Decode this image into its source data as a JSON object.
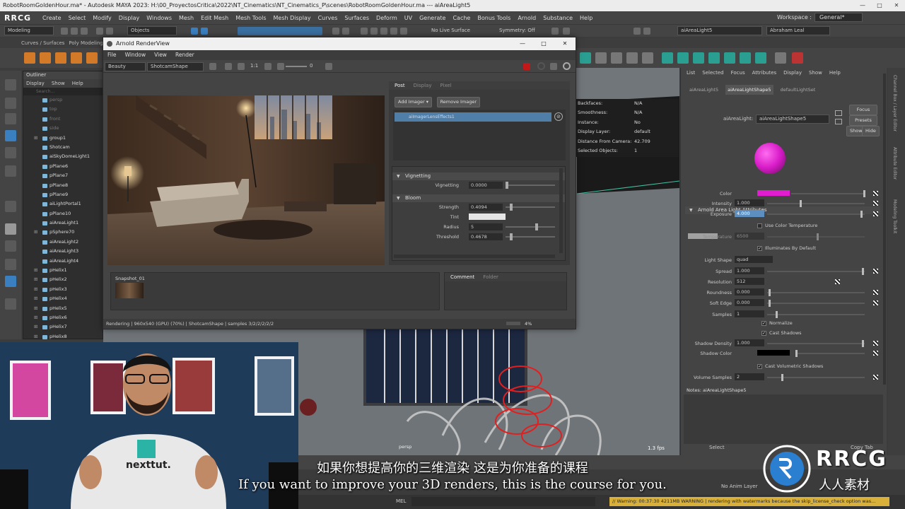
{
  "app": {
    "title": "RobotRoomGoldenHour.ma* - Autodesk MAYA 2023: H:\\00_ProyectosCritica\\2022\\NT_Cinematics\\NT_Cinematics_P\\scenes\\RobotRoomGoldenHour.ma  ---  aiAreaLight5",
    "menus": [
      "Create",
      "Select",
      "Modify",
      "Display",
      "Windows",
      "Mesh",
      "Edit Mesh",
      "Mesh Tools",
      "Mesh Display",
      "Curves",
      "Surfaces",
      "Deform",
      "UV",
      "Generate",
      "Cache",
      "Bonus Tools",
      "Arnold",
      "Substance",
      "Help"
    ],
    "workspace_label": "Workspace :",
    "workspace_value": "General*",
    "mode": "Modeling",
    "objects_label": "Objects",
    "live_surface": "No Live Surface",
    "symmetry": "Symmetry: Off",
    "selected_name": "aiAreaLight5",
    "user": "Abraham Leal",
    "shelf_tabs": [
      "Curves / Surfaces",
      "Poly Modeling"
    ]
  },
  "outliner": {
    "title": "Outliner",
    "menu": [
      "Display",
      "Show",
      "Help"
    ],
    "search": "Search...",
    "items": [
      {
        "label": "persp",
        "dim": true
      },
      {
        "label": "top",
        "dim": true
      },
      {
        "label": "front",
        "dim": true
      },
      {
        "label": "side",
        "dim": true
      },
      {
        "label": "group1",
        "dim": false,
        "expand": true
      },
      {
        "label": "Shotcam",
        "dim": false
      },
      {
        "label": "aiSkyDomeLight1",
        "dim": false
      },
      {
        "label": "pPlane6",
        "dim": false
      },
      {
        "label": "pPlane7",
        "dim": false
      },
      {
        "label": "pPlane8",
        "dim": false
      },
      {
        "label": "pPlane9",
        "dim": false
      },
      {
        "label": "aiLightPortal1",
        "dim": false
      },
      {
        "label": "pPlane10",
        "dim": false
      },
      {
        "label": "aiAreaLight1",
        "dim": false
      },
      {
        "label": "pSphere70",
        "dim": false,
        "expand": true
      },
      {
        "label": "aiAreaLight2",
        "dim": false
      },
      {
        "label": "aiAreaLight3",
        "dim": false
      },
      {
        "label": "aiAreaLight4",
        "dim": false
      },
      {
        "label": "pHelix1",
        "dim": false,
        "expand": true
      },
      {
        "label": "pHelix2",
        "dim": false,
        "expand": true
      },
      {
        "label": "pHelix3",
        "dim": false,
        "expand": true
      },
      {
        "label": "pHelix4",
        "dim": false,
        "expand": true
      },
      {
        "label": "pHelix5",
        "dim": false,
        "expand": true
      },
      {
        "label": "pHelix6",
        "dim": false,
        "expand": true
      },
      {
        "label": "pHelix7",
        "dim": false,
        "expand": true
      },
      {
        "label": "pHelix8",
        "dim": false,
        "expand": true
      }
    ]
  },
  "renderview": {
    "title": "Arnold RenderView",
    "menu": [
      "File",
      "Window",
      "View",
      "Render"
    ],
    "aov": "Beauty",
    "camera": "ShotcamShape",
    "ratio": "1:1",
    "exposure_value": "0",
    "tabs": [
      "Post",
      "Display",
      "Pixel"
    ],
    "add_imager": "Add Imager",
    "remove_imager": "Remove Imager",
    "imager_name": "aiImagerLensEffects1",
    "vignetting_section": "Vignetting",
    "vignetting_label": "Vignetting",
    "vignetting_value": "0.0000",
    "vignetting_level": 0.0,
    "bloom_section": "Bloom",
    "strength_label": "Strength",
    "strength_value": "0.4094",
    "tint_label": "Tint",
    "radius_label": "Radius",
    "radius_value": "5",
    "threshold_label": "Threshold",
    "threshold_value": "0.4678",
    "snapshot_label": "Snapshot_01",
    "comment_tabs": [
      "Comment",
      "Folder"
    ],
    "status": "Rendering | 960x540 (GPU) (70%) | ShotcamShape | samples 3/2/2/2/2/2",
    "zoom": "4%"
  },
  "hud": {
    "rows": [
      {
        "l": "Backfaces:",
        "v": "N/A"
      },
      {
        "l": "Smoothness:",
        "v": "N/A"
      },
      {
        "l": "Instance:",
        "v": "No"
      },
      {
        "l": "Display Layer:",
        "v": "default"
      },
      {
        "l": "Distance From Camera:",
        "v": "42.709"
      },
      {
        "l": "Selected Objects:",
        "v": "1"
      }
    ],
    "camera": "persp",
    "fps": "1.3 fps"
  },
  "attr": {
    "menu": [
      "List",
      "Selected",
      "Focus",
      "Attributes",
      "Display",
      "Show",
      "Help"
    ],
    "tabs": [
      "aiAreaLight5",
      "aiAreaLightShape5",
      "defaultLightSet"
    ],
    "node_label": "aiAreaLight:",
    "node_value": "aiAreaLightShape5",
    "focus": "Focus",
    "presets": "Presets",
    "show": "Show",
    "hide": "Hide",
    "section": "Arnold Area Light Attributes",
    "color_label": "Color",
    "intensity_label": "Intensity",
    "intensity_value": "1.000",
    "exposure_label": "Exposure",
    "exposure_value": "4.000",
    "use_color_temp": "Use Color Temperature",
    "temperature_label": "Temperature",
    "temperature_value": "6500",
    "illuminates": "Illuminates By Default",
    "light_shape_label": "Light Shape",
    "light_shape_value": "quad",
    "spread_label": "Spread",
    "spread_value": "1.000",
    "resolution_label": "Resolution",
    "resolution_value": "512",
    "roundness_label": "Roundness",
    "roundness_value": "0.000",
    "softedge_label": "Soft Edge",
    "softedge_value": "0.000",
    "samples_label": "Samples",
    "samples_value": "1",
    "normalize": "Normalize",
    "cast_shadows": "Cast Shadows",
    "shadow_density_label": "Shadow Density",
    "shadow_density_value": "1.000",
    "shadow_color_label": "Shadow Color",
    "cast_vol_shadows": "Cast Volumetric Shadows",
    "vol_samples_label": "Volume Samples",
    "vol_samples_value": "2",
    "notes": "Notes:  aiAreaLightShape5",
    "select_btn": "Select",
    "copy_tab": "Copy Tab",
    "color_hex": "#e01ed0"
  },
  "right_strip": [
    "Channel Box / Layer Editor",
    "Attribute Editor",
    "Modeling Toolkit"
  ],
  "bottom": {
    "anim_layer": "No Anim Layer",
    "mel": "MEL",
    "warning": "// Warning: 00:37:30  4211MB WARNING | rendering with watermarks because the skip_license_check option was..."
  },
  "overlay": {
    "subtitle_cn": "如果你想提高你的三维渲染 这是为你准备的课程",
    "subtitle_en": "If you want to improve your 3D renders, this is the course for you.",
    "shirt_text": "nexttut.",
    "logo_text": "RRCG",
    "logo_sub": "人人素材",
    "watermark_small": "RRCG"
  }
}
